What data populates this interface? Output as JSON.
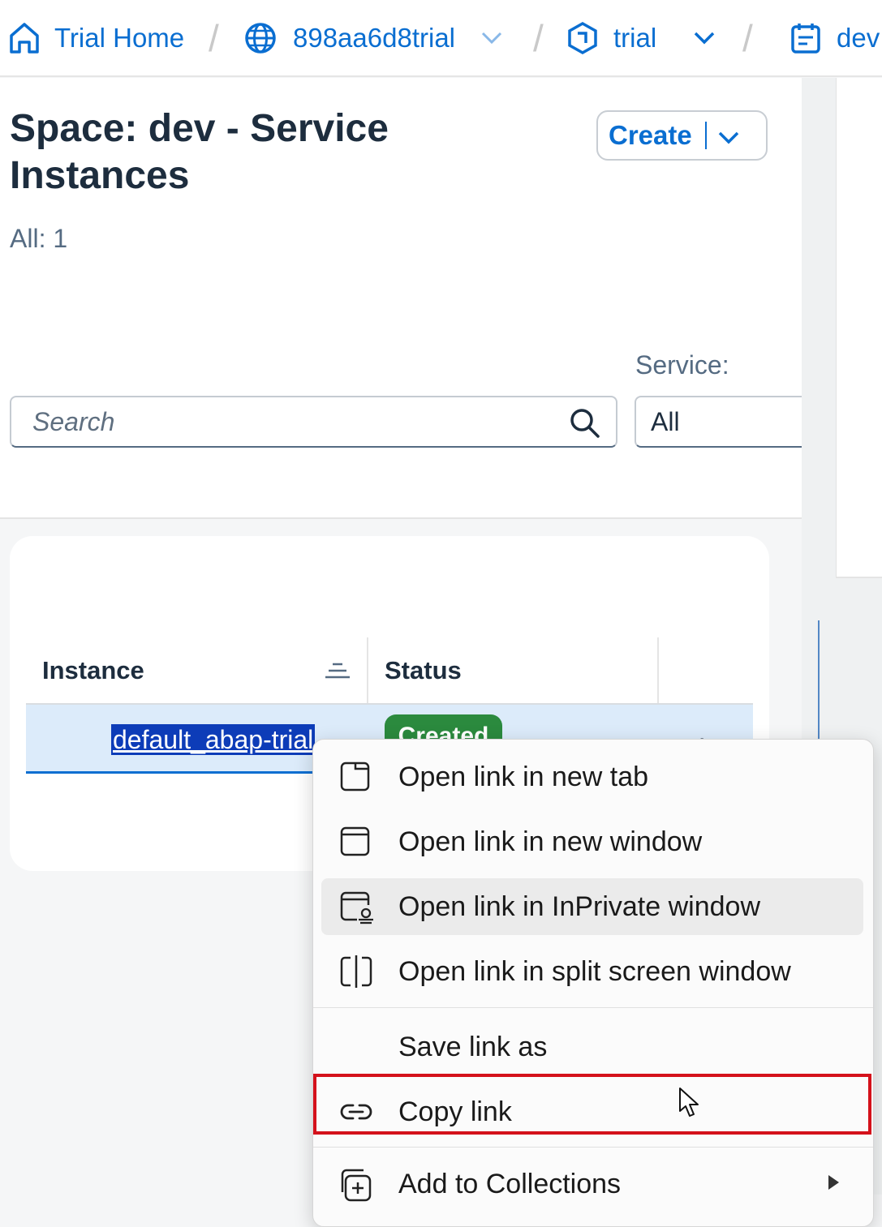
{
  "breadcrumb": {
    "home": "Trial Home",
    "subaccount": "898aa6d8trial",
    "org": "trial",
    "space": "dev"
  },
  "page": {
    "title": "Space: dev - Service Instances",
    "count": "All: 1",
    "create_label": "Create"
  },
  "filters": {
    "search_placeholder": "Search",
    "service_label": "Service:",
    "service_value": "All"
  },
  "table": {
    "columns": [
      "Instance",
      "Status"
    ],
    "rows": [
      {
        "instance": "default_abap-trial",
        "status": "Created"
      }
    ]
  },
  "context_menu": {
    "items": [
      {
        "label": "Open link in new tab",
        "icon": "new-tab-icon"
      },
      {
        "label": "Open link in new window",
        "icon": "new-window-icon"
      },
      {
        "label": "Open link in InPrivate window",
        "icon": "inprivate-window-icon"
      },
      {
        "label": "Open link in split screen window",
        "icon": "split-screen-icon"
      },
      {
        "label": "Save link as",
        "icon": ""
      },
      {
        "label": "Copy link",
        "icon": "link-icon"
      },
      {
        "label": "Add to Collections",
        "icon": "collections-icon"
      }
    ],
    "highlight_color": "#d4111b"
  },
  "colors": {
    "accent": "#0a6ed1",
    "status_created": "#2b8a3e",
    "selection": "#0d3cb8"
  }
}
